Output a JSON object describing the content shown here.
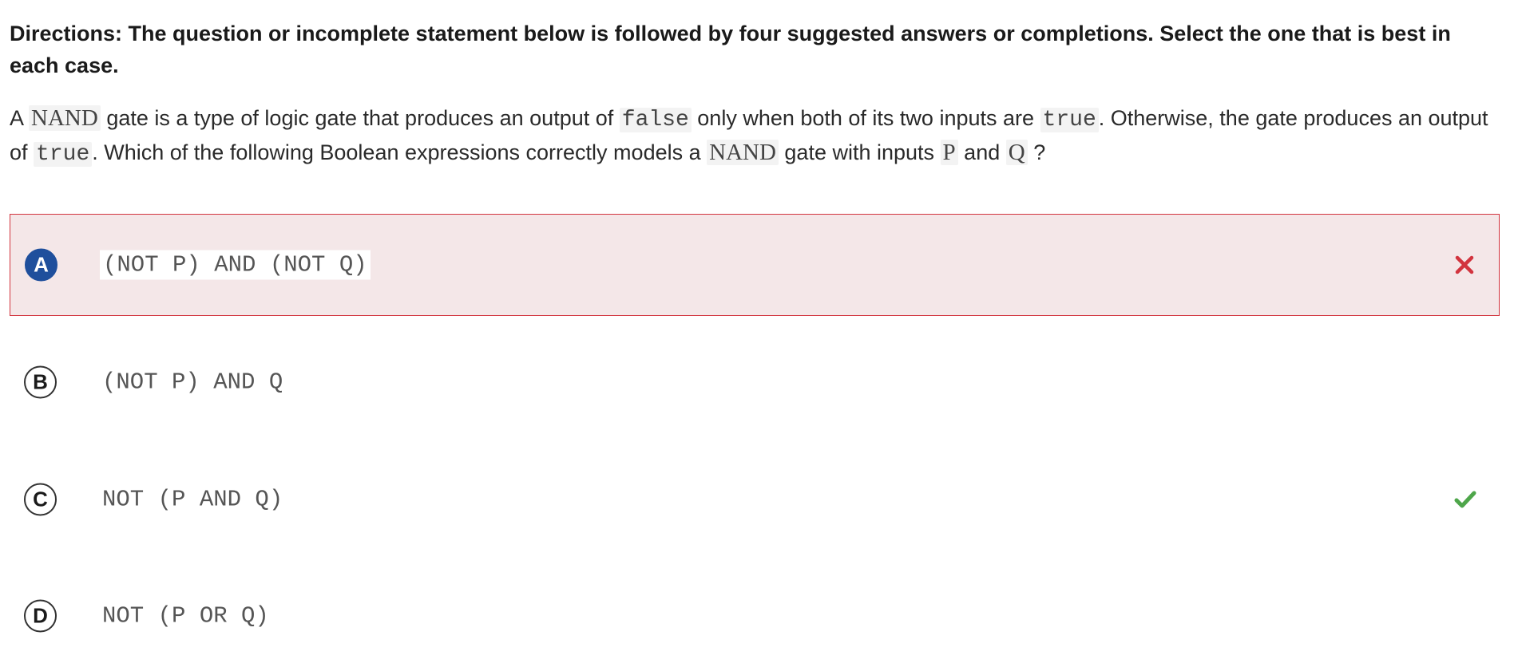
{
  "directions": "Directions: The question or incomplete statement below is followed by four suggested answers or completions. Select the one that is best in each case.",
  "stem": {
    "p1": "A ",
    "c1": "NAND",
    "p2": " gate is a type of logic gate that produces an output of ",
    "c2": "false",
    "p3": " only when both of its two inputs are ",
    "c3": "true",
    "p4": ". Otherwise, the gate produces an output of ",
    "c4": "true",
    "p5": ". Which of the following Boolean expressions correctly models a ",
    "c5": "NAND",
    "p6": " gate with inputs ",
    "c6": "P",
    "p7": " and ",
    "c7": "Q",
    "p8": " ?"
  },
  "choices": [
    {
      "letter": "A",
      "text": "(NOT P) AND (NOT Q)",
      "state": "selected-incorrect",
      "mark_icon": "x-icon"
    },
    {
      "letter": "B",
      "text": "(NOT P) AND Q",
      "state": "unselected"
    },
    {
      "letter": "C",
      "text": "NOT (P AND Q)",
      "state": "correct",
      "mark_icon": "check-icon"
    },
    {
      "letter": "D",
      "text": "NOT (P OR Q)",
      "state": "unselected"
    }
  ],
  "colors": {
    "incorrect": "#d2343e",
    "selected_bg": "#f4e7e8",
    "correct": "#4ea64a",
    "selected_letter_bg": "#1f4f9c"
  }
}
